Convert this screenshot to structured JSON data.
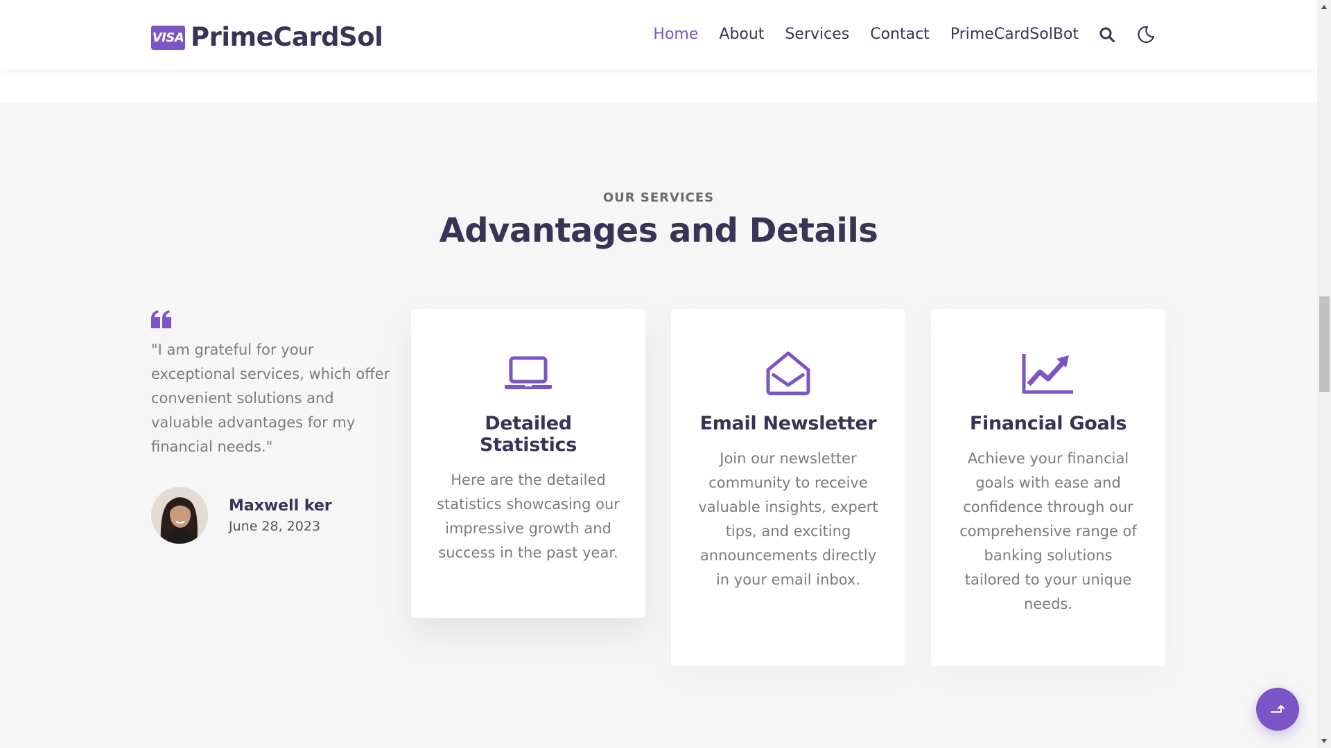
{
  "header": {
    "logo_badge": "VISA",
    "logo_text": "PrimeCardSol",
    "nav": {
      "home": "Home",
      "about": "About",
      "services": "Services",
      "contact": "Contact",
      "bot": "PrimeCardSolBot"
    },
    "icons": [
      "search-icon",
      "moon-icon"
    ]
  },
  "section": {
    "eyebrow": "OUR SERVICES",
    "title": "Advantages and Details"
  },
  "testimonial": {
    "quote": "\"I am grateful for your exceptional services, which offer convenient solutions and valuable advantages for my financial needs.\"",
    "author_name": "Maxwell ker",
    "author_date": "June 28, 2023"
  },
  "cards": [
    {
      "icon": "laptop-icon",
      "title": "Detailed Statistics",
      "text": "Here are the detailed statistics showcasing our impressive growth and success in the past year."
    },
    {
      "icon": "envelope-open-icon",
      "title": "Email Newsletter",
      "text": "Join our newsletter community to receive valuable insights, expert tips, and exciting announcements directly in your email inbox."
    },
    {
      "icon": "chart-line-icon",
      "title": "Financial Goals",
      "text": "Achieve your financial goals with ease and confidence through our comprehensive range of banking solutions tailored to your unique needs."
    }
  ],
  "colors": {
    "accent": "#7b55c7",
    "heading": "#3a3355",
    "body_text": "#7a7a80",
    "background": "#f6f6f6"
  }
}
